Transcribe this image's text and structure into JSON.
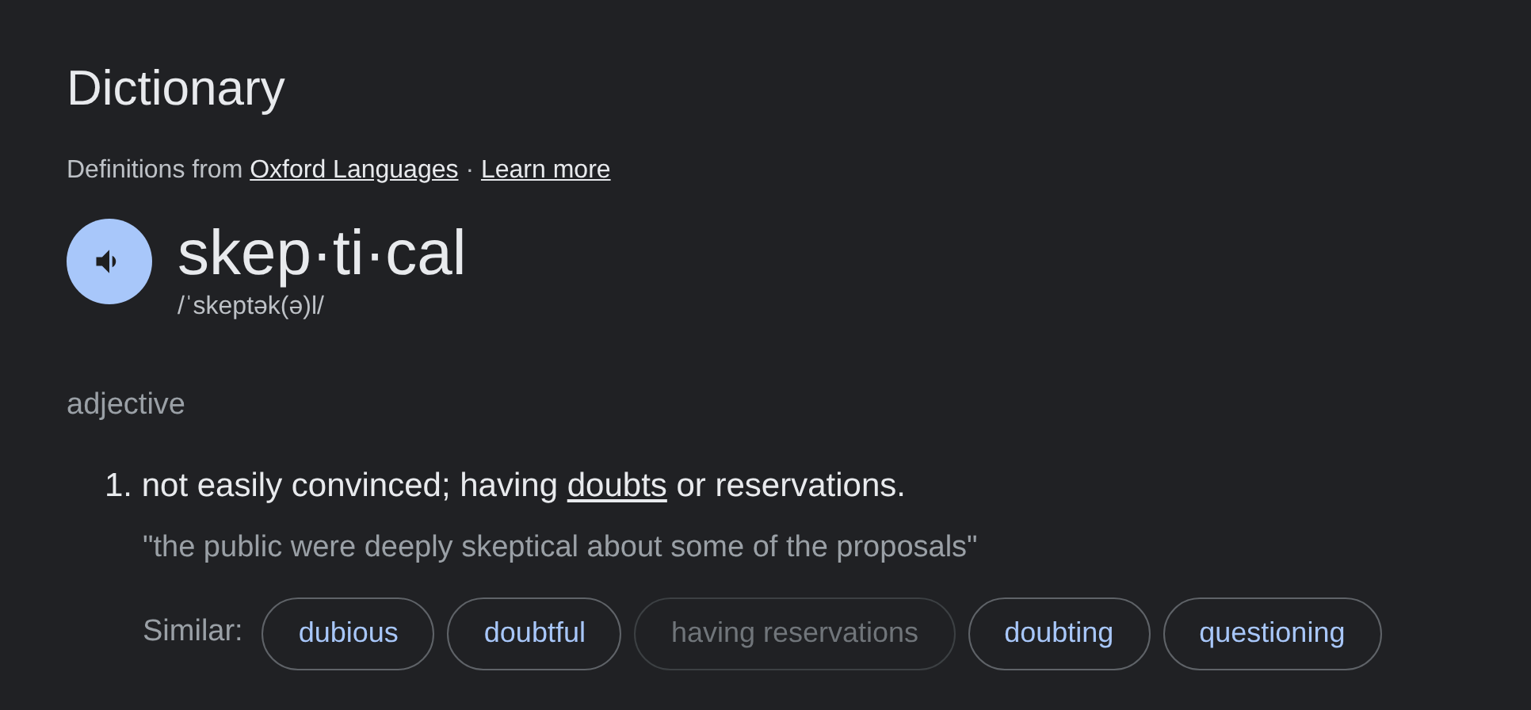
{
  "heading": "Dictionary",
  "source": {
    "prefix": "Definitions from",
    "link": "Oxford Languages",
    "separator": "·",
    "learn_more": "Learn more"
  },
  "entry": {
    "word": "skep·ti·cal",
    "pronunciation": "/ˈskeptək(ə)l/"
  },
  "part_of_speech": "adjective",
  "definitions": [
    {
      "number": "1.",
      "before": "not easily convinced; having",
      "link": "doubts",
      "after": "or reservations.",
      "example": "\"the public were deeply skeptical about some of the proposals\"",
      "similar_label": "Similar:",
      "similar": [
        {
          "label": "dubious",
          "disabled": false
        },
        {
          "label": "doubtful",
          "disabled": false
        },
        {
          "label": "having reservations",
          "disabled": true
        },
        {
          "label": "doubting",
          "disabled": false
        },
        {
          "label": "questioning",
          "disabled": false
        }
      ]
    }
  ]
}
